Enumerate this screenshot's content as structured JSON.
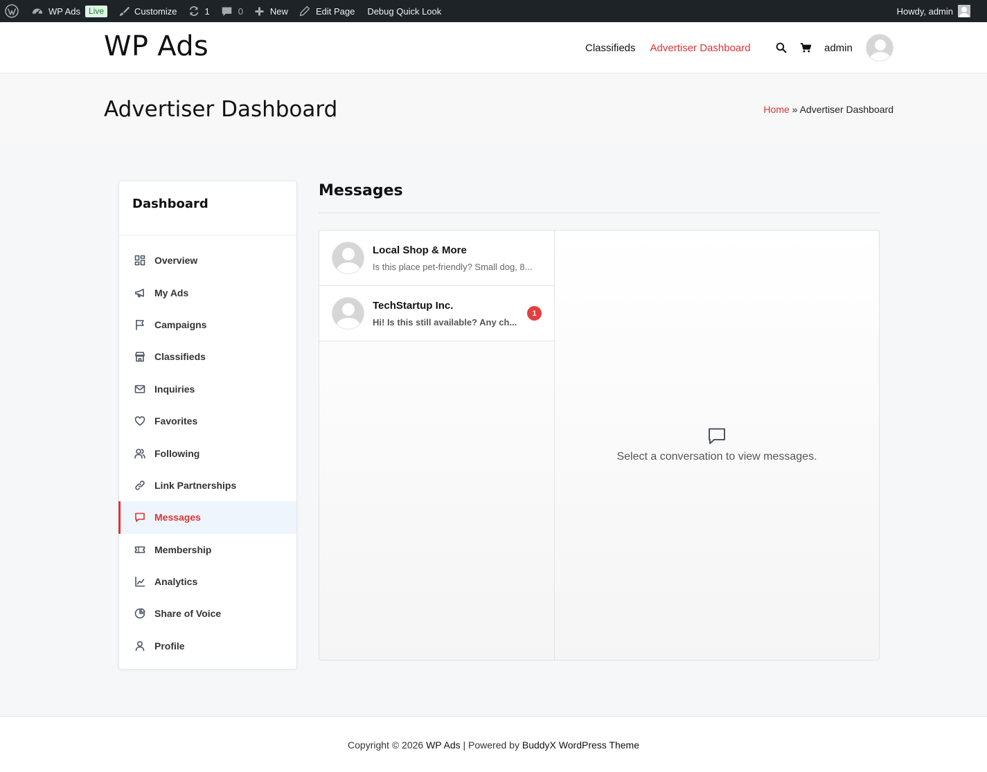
{
  "admin_bar": {
    "site_name": "WP Ads",
    "live_badge": "Live",
    "customize": "Customize",
    "updates_count": "1",
    "comments_count": "0",
    "new_label": "New",
    "edit_page": "Edit Page",
    "debug": "Debug Quick Look",
    "howdy": "Howdy, admin"
  },
  "header": {
    "logo": "WP Ads",
    "nav": [
      {
        "label": "Classifieds"
      },
      {
        "label": "Advertiser Dashboard"
      }
    ],
    "user_label": "admin"
  },
  "page": {
    "title": "Advertiser Dashboard",
    "breadcrumb_home": "Home",
    "breadcrumb_sep": "»",
    "breadcrumb_current": "Advertiser Dashboard"
  },
  "sidebar": {
    "title": "Dashboard",
    "items": [
      {
        "label": "Overview",
        "icon": "grid-icon"
      },
      {
        "label": "My Ads",
        "icon": "megaphone-icon"
      },
      {
        "label": "Campaigns",
        "icon": "flag-icon"
      },
      {
        "label": "Classifieds",
        "icon": "store-icon"
      },
      {
        "label": "Inquiries",
        "icon": "mail-icon"
      },
      {
        "label": "Favorites",
        "icon": "heart-icon"
      },
      {
        "label": "Following",
        "icon": "users-icon"
      },
      {
        "label": "Link Partnerships",
        "icon": "link-icon"
      },
      {
        "label": "Messages",
        "icon": "message-icon",
        "active": true
      },
      {
        "label": "Membership",
        "icon": "ticket-icon"
      },
      {
        "label": "Analytics",
        "icon": "chart-icon"
      },
      {
        "label": "Share of Voice",
        "icon": "pie-icon"
      },
      {
        "label": "Profile",
        "icon": "user-icon"
      }
    ]
  },
  "messages": {
    "title": "Messages",
    "conversations": [
      {
        "name": "Local Shop & More",
        "snippet": "Is this place pet-friendly? Small dog, 8..."
      },
      {
        "name": "TechStartup Inc.",
        "snippet": "Hi! Is this still available? Any ch...",
        "unread": "1"
      }
    ],
    "empty_text": "Select a conversation to view messages."
  },
  "footer": {
    "prefix": "Copyright © 2026 ",
    "site": "WP Ads",
    "middle": " | Powered by ",
    "theme": "BuddyX WordPress Theme"
  },
  "colors": {
    "accent": "#dd3333",
    "admin_bar": "#1d2327",
    "badge": "#e53e3e"
  }
}
